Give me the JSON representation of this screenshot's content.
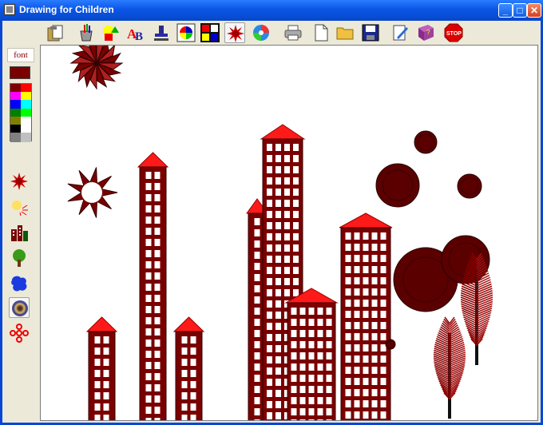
{
  "window": {
    "title": "Drawing for Children"
  },
  "titlebar_buttons": [
    "minimize-button",
    "maximize-button",
    "close-button"
  ],
  "toolbar": {
    "tools": [
      {
        "name": "paste-tool-icon"
      },
      {
        "name": "paint-bucket-tool-icon"
      },
      {
        "name": "shapes-tool-icon"
      },
      {
        "name": "text-tool-icon"
      },
      {
        "name": "stamp-tool-icon"
      },
      {
        "name": "color-wheel-tool-icon"
      },
      {
        "name": "mondrian-tool-icon"
      },
      {
        "name": "spiky-star-tool-icon",
        "active": true
      },
      {
        "name": "swirl-tool-icon"
      },
      {
        "name": "print-icon"
      },
      {
        "name": "new-document-icon"
      },
      {
        "name": "open-folder-icon"
      },
      {
        "name": "save-disk-icon"
      },
      {
        "name": "edit-properties-icon"
      },
      {
        "name": "help-book-icon"
      },
      {
        "name": "stop-icon"
      }
    ]
  },
  "left_panel": {
    "font_label": "font",
    "current_color": "#7a0000",
    "palette": [
      "#800000",
      "#ff0000",
      "#ff00ff",
      "#ffff00",
      "#0000ff",
      "#00ffff",
      "#008000",
      "#00ff00",
      "#808000",
      "#ffffff",
      "#000000",
      "#ffffff",
      "#808080",
      "#c0c0c0"
    ],
    "brushes": [
      "star-brush-icon",
      "spray-brush-icon",
      "buildings-brush-icon",
      "tree-brush-icon",
      "blob-brush-icon",
      "circle-brush-icon",
      "flower-brush-icon"
    ],
    "active_brush": "circle-brush-icon"
  },
  "colors": {
    "building": "#7a0000",
    "roof": "#ff1a1a",
    "window": "#ffffff",
    "circle": "#5a0000"
  }
}
